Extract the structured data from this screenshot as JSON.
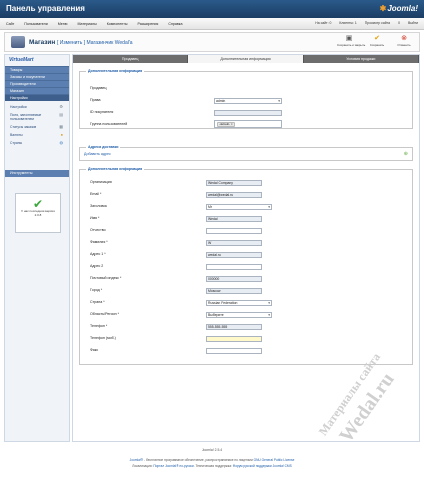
{
  "header": {
    "title": "Панель управления",
    "logo": "Joomla!"
  },
  "menu": {
    "items": [
      "Сайт",
      "Пользователи",
      "Меню",
      "Материалы",
      "Компоненты",
      "Расширения",
      "Справка"
    ],
    "right": [
      "На сайт: 0",
      "Клиенты: 1",
      "Просмотр сайта",
      "0",
      "Выйти"
    ]
  },
  "toolbar": {
    "title": "Магазин",
    "subtitle": "[ Изменить ] Магазинчик Wedal'a",
    "buttons": [
      {
        "label": "Сохранить и закрыть",
        "icon": "save-close-icon",
        "color": "#555555"
      },
      {
        "label": "Сохранить",
        "icon": "check-icon",
        "color": "#e8a000"
      },
      {
        "label": "Отменить",
        "icon": "cancel-icon",
        "color": "#d23a2a"
      }
    ]
  },
  "sidebar": {
    "logo": "VirtueMart",
    "categories": [
      "Товары",
      "Заказы и покупатели",
      "Производители",
      "Магазин",
      "Настройки"
    ],
    "links": [
      {
        "label": "Настройки",
        "icon": "gear-icon"
      },
      {
        "label": "Поля, заполняемые пользователем",
        "icon": "fields-icon"
      },
      {
        "label": "Статусы заказов",
        "icon": "status-icon"
      },
      {
        "label": "Валюты",
        "icon": "currency-icon"
      },
      {
        "label": "Страны",
        "icon": "globe-icon"
      }
    ],
    "tools": "Инструменты",
    "support_text": "У нас последняя версия 2.0.8"
  },
  "tabs": [
    "Продавец",
    "Дополнительная информация",
    "Условия продажи"
  ],
  "section1": {
    "legend": "Дополнительная информация",
    "seller_label": "Продавец",
    "rows": [
      {
        "label": "Права",
        "value": "admin"
      },
      {
        "label": "ID покупателя",
        "value": ""
      },
      {
        "label": "Группа пользователей",
        "value": "-default-"
      }
    ]
  },
  "section2": {
    "legend": "Адреса доставки",
    "add_link": "Добавить адрес"
  },
  "section3": {
    "legend": "Дополнительная информация",
    "fields": [
      {
        "label": "Организация",
        "value": "Wedal Company"
      },
      {
        "label": "Email *",
        "value": "wedal@wedal.ru"
      },
      {
        "label": "Заголовок",
        "value": "Mr"
      },
      {
        "label": "Имя *",
        "value": "Wedal"
      },
      {
        "label": "Отчество",
        "value": ""
      },
      {
        "label": "Фамилия *",
        "value": "W"
      },
      {
        "label": "Адрес 1 *",
        "value": "wedal.ru"
      },
      {
        "label": "Адрес 2",
        "value": ""
      },
      {
        "label": "Почтовый индекс *",
        "value": "000000"
      },
      {
        "label": "Город *",
        "value": "Moscow"
      },
      {
        "label": "Страна *",
        "value": "Russian Federation"
      },
      {
        "label": "Область/Регион *",
        "value": "Выберите"
      },
      {
        "label": "Телефон *",
        "value": "555-555-555"
      },
      {
        "label": "Телефон (моб.)",
        "value": ""
      },
      {
        "label": "Факс",
        "value": ""
      }
    ]
  },
  "footer": {
    "version": "Joomla! 2.5.4",
    "line1_link": "Joomla!®",
    "line1_text": " - бесплатное программное обеспечение, распространяемое по лицензии ",
    "line1_license": "GNU General Public License",
    "line2_text": "Локализация: ",
    "line2_link1": "Портал Joomla!® по-русски",
    "line2_mid": ". Техническая поддержка: ",
    "line2_link2": "Форум русской поддержки Joomla! CMS"
  },
  "watermark": {
    "line1": "Материалы сайта",
    "line2": "Wedal.ru"
  }
}
